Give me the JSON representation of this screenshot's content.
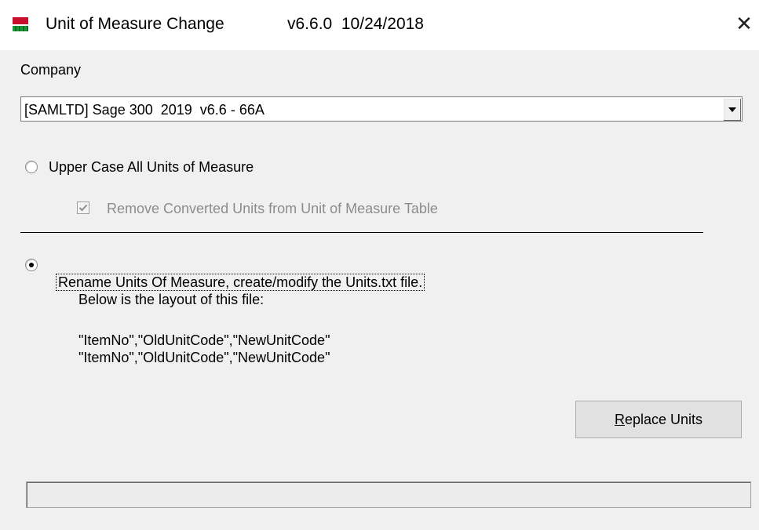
{
  "window": {
    "title": "Unit of Measure Change",
    "version": "v6.6.0  10/24/2018",
    "close_glyph": "✕"
  },
  "company": {
    "label": "Company",
    "selected": "[SAMLTD] Sage 300  2019  v6.6 - 66A"
  },
  "options": {
    "upper_case_label": "Upper Case All Units of Measure",
    "remove_converted_label": "Remove Converted Units from Unit of Measure Table",
    "rename_label": "Rename Units Of Measure, create/modify the Units.txt file.",
    "layout_intro": "Below is the layout of this file:",
    "layout_line1": "\"ItemNo\",\"OldUnitCode\",\"NewUnitCode\"",
    "layout_line2": "\"ItemNo\",\"OldUnitCode\",\"NewUnitCode\""
  },
  "actions": {
    "replace_units_label": "Replace Units",
    "replace_units_mnemonic": "R",
    "replace_units_rest": "eplace Units"
  },
  "state": {
    "upper_case_selected": false,
    "rename_selected": true,
    "remove_converted_checked": true,
    "remove_converted_enabled": false,
    "progress": 0
  },
  "icons": {
    "app": "app-icon",
    "close": "close-icon",
    "dropdown": "chevron-down-icon"
  }
}
